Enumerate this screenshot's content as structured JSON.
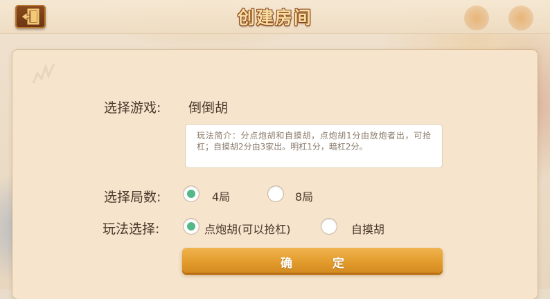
{
  "header": {
    "title": "创建房间",
    "back_icon": "exit-door-icon"
  },
  "form": {
    "game_label": "选择游戏:",
    "game_value": "倒倒胡",
    "rules_text": "玩法简介：分点炮胡和自摸胡，点炮胡1分由放炮者出，可抢杠；自摸胡2分由3家出。明杠1分，暗杠2分。",
    "rounds_label": "选择局数:",
    "rounds_options": [
      {
        "label": "4局",
        "selected": true
      },
      {
        "label": "8局",
        "selected": false
      }
    ],
    "mode_label": "玩法选择:",
    "mode_options": [
      {
        "label": "点炮胡(可以抢杠)",
        "selected": true
      },
      {
        "label": "自摸胡",
        "selected": false
      }
    ],
    "confirm_label": "确 定"
  },
  "colors": {
    "accent_button": "#e39c2d",
    "radio_selected": "#55b889",
    "title_text": "#f7dda1",
    "panel_bg": "#f6e4cc"
  }
}
